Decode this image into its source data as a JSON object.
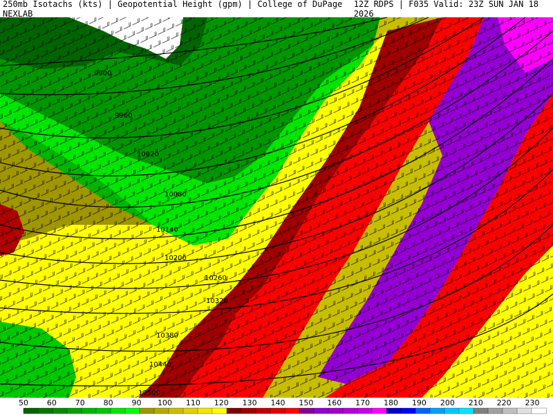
{
  "header": {
    "left_title": "250mb Isotachs (kts) | Geopotential Height (gpm) | College of DuPage NEXLAB",
    "right_title": "12Z RDPS | F035 Valid: 23Z SUN JAN 18 2026"
  },
  "colorbar": {
    "labels": [
      "50",
      "60",
      "70",
      "80",
      "90",
      "100",
      "110",
      "120",
      "130",
      "140",
      "150",
      "160",
      "170",
      "180",
      "190",
      "200",
      "210",
      "220",
      "230"
    ],
    "colors": [
      "#006400",
      "#007800",
      "#008c00",
      "#00a000",
      "#00b400",
      "#00c800",
      "#00e600",
      "#00ff00",
      "#a09600",
      "#b4aa00",
      "#c8be00",
      "#dcd200",
      "#f0e600",
      "#ffff00",
      "#800000",
      "#a00000",
      "#c00000",
      "#e00000",
      "#ff0000",
      "#8b008b",
      "#9400d3",
      "#a000c8",
      "#b400dc",
      "#c800e6",
      "#ff00ff",
      "#0000c8",
      "#0000ff",
      "#0064ff",
      "#00a0ff",
      "#00c8ff",
      "#00e6ff",
      "#808080",
      "#a0a0a0",
      "#c0c0c0",
      "#e0e0e0",
      "#ffffff"
    ]
  },
  "contours": [
    "9900",
    "9960",
    "10020",
    "10080",
    "10140",
    "10200",
    "10260",
    "10320",
    "10380",
    "10440",
    "10500"
  ]
}
